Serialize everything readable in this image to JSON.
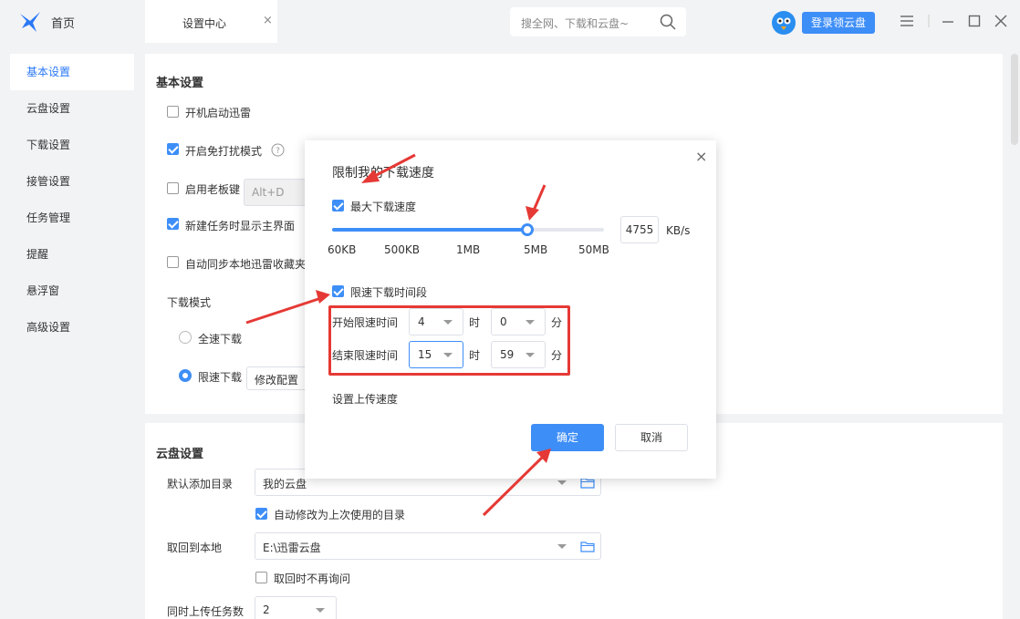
{
  "titlebar": {
    "home_label": "首页",
    "tab_label": "设置中心",
    "tab_close": "×",
    "search_placeholder": "搜全网、下载和云盘~",
    "login_button": "登录领云盘"
  },
  "sidebar": {
    "items": [
      {
        "label": "基本设置",
        "active": true
      },
      {
        "label": "云盘设置"
      },
      {
        "label": "下载设置"
      },
      {
        "label": "接管设置"
      },
      {
        "label": "任务管理"
      },
      {
        "label": "提醒"
      },
      {
        "label": "悬浮窗"
      },
      {
        "label": "高级设置"
      }
    ]
  },
  "basic": {
    "title": "基本设置",
    "autostart": {
      "label": "开机启动迅雷",
      "checked": false
    },
    "dnd": {
      "label": "开启免打扰模式",
      "checked": true
    },
    "boss_key": {
      "label": "启用老板键",
      "checked": false,
      "value": "Alt+D"
    },
    "show_main": {
      "label": "新建任务时显示主界面",
      "checked": true
    },
    "sync_fav": {
      "label": "自动同步本地迅雷收藏夹",
      "checked": false
    },
    "download_mode_label": "下载模式",
    "mode_full": "全速下载",
    "mode_limited": "限速下载",
    "modify_config": "修改配置"
  },
  "cloud": {
    "title": "云盘设置",
    "default_dir_label": "默认添加目录",
    "default_dir_value": "我的云盘",
    "auto_modify": {
      "label": "自动修改为上次使用的目录",
      "checked": true
    },
    "fetch_local_label": "取回到本地",
    "fetch_local_value": "E:\\迅雷云盘",
    "no_ask": {
      "label": "取回时不再询问",
      "checked": false
    },
    "concurrent_label": "同时上传任务数",
    "concurrent_value": "2"
  },
  "modal": {
    "title": "限制我的下载速度",
    "close": "×",
    "max_speed": {
      "label": "最大下载速度",
      "checked": true
    },
    "slider_level": 0.719,
    "ticks": [
      "60KB",
      "500KB",
      "1MB",
      "5MB",
      "50MB"
    ],
    "speed_value": "4755",
    "speed_unit": "KB/s",
    "time_limit": {
      "label": "限速下载时间段",
      "checked": true
    },
    "start_label": "开始限速时间",
    "end_label": "结束限速时间",
    "start_hour": "4",
    "start_min": "0",
    "end_hour": "15",
    "end_min": "59",
    "hour_unit": "时",
    "min_unit": "分",
    "upload_link": "设置上传速度",
    "ok": "确定",
    "cancel": "取消"
  },
  "colors": {
    "accent": "#3e8ef7",
    "annotation": "#e53935"
  }
}
